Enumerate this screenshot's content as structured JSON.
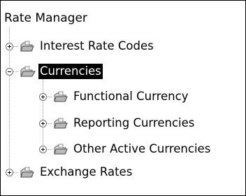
{
  "tree": {
    "root_label": "Rate Manager",
    "nodes": [
      {
        "label": "Interest Rate Codes",
        "state": "collapsed",
        "level": 1,
        "selected": false,
        "icon": "folder-icon"
      },
      {
        "label": "Currencies",
        "state": "expanded",
        "level": 1,
        "selected": true,
        "icon": "folder-icon"
      },
      {
        "label": "Functional Currency",
        "state": "collapsed",
        "level": 2,
        "selected": false,
        "icon": "folder-icon"
      },
      {
        "label": "Reporting Currencies",
        "state": "collapsed",
        "level": 2,
        "selected": false,
        "icon": "folder-icon"
      },
      {
        "label": "Other Active Currencies",
        "state": "collapsed",
        "level": 2,
        "selected": false,
        "icon": "folder-icon"
      },
      {
        "label": "Exchange Rates",
        "state": "collapsed",
        "level": 1,
        "selected": false,
        "icon": "folder-icon"
      }
    ]
  },
  "colors": {
    "selection_background": "#000000",
    "selection_text": "#ffffff",
    "tree_lines": "#9a9a9a"
  }
}
